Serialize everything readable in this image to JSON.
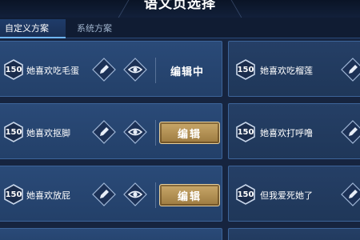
{
  "header": {
    "title": "语文页选择"
  },
  "tabs": [
    {
      "label": "自定义方案",
      "active": true
    },
    {
      "label": "系统方案",
      "active": false
    }
  ],
  "left_cards": [
    {
      "cost": "150",
      "phrase": "她喜欢吃毛蛋",
      "status": "编辑中",
      "button_label": ""
    },
    {
      "cost": "150",
      "phrase": "她喜欢抠脚",
      "status": "",
      "button_label": "编辑"
    },
    {
      "cost": "150",
      "phrase": "她喜欢放屁",
      "status": "",
      "button_label": "编辑"
    }
  ],
  "right_cards": [
    {
      "cost": "150",
      "phrase": "她喜欢吃榴莲"
    },
    {
      "cost": "150",
      "phrase": "她喜欢打呼噜"
    },
    {
      "cost": "150",
      "phrase": "但我爱死她了"
    }
  ],
  "colors": {
    "background": "#16243f",
    "card": "#2a4a78",
    "gold_button": "#b8955a",
    "accent": "#6fb6ff"
  },
  "icons": [
    "pencil-icon",
    "eye-icon",
    "cost-badge-hexagon"
  ]
}
